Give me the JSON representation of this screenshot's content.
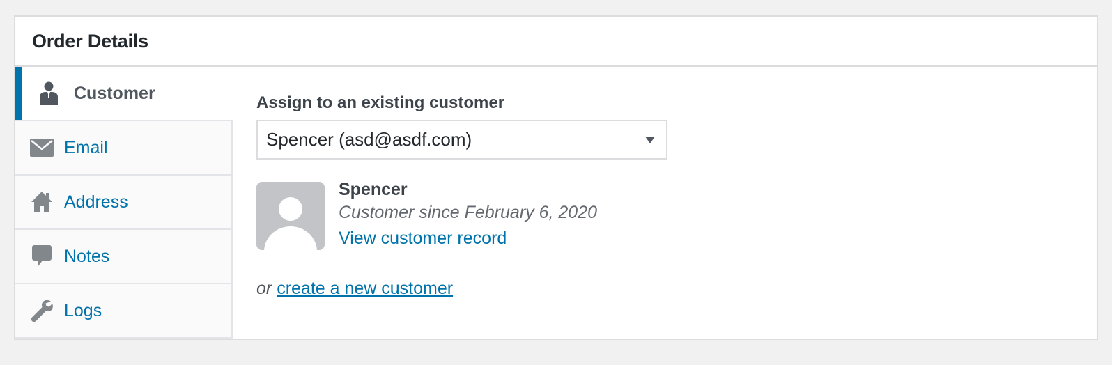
{
  "panel": {
    "title": "Order Details"
  },
  "sidebar": {
    "tabs": [
      {
        "label": "Customer",
        "icon": "person-icon",
        "active": true
      },
      {
        "label": "Email",
        "icon": "envelope-icon",
        "active": false
      },
      {
        "label": "Address",
        "icon": "home-icon",
        "active": false
      },
      {
        "label": "Notes",
        "icon": "speech-bubble-icon",
        "active": false
      },
      {
        "label": "Logs",
        "icon": "wrench-icon",
        "active": false
      }
    ]
  },
  "customer": {
    "assign_label": "Assign to an existing customer",
    "selected_customer": "Spencer (asd@asdf.com)",
    "name": "Spencer",
    "since": "Customer since February 6, 2020",
    "record_link": "View customer record",
    "or_text": "or",
    "create_link": "create a new customer"
  },
  "colors": {
    "accent": "#0073aa",
    "border": "#dcdcde",
    "background": "#f1f1f1",
    "avatar_bg": "#c3c4c7"
  }
}
